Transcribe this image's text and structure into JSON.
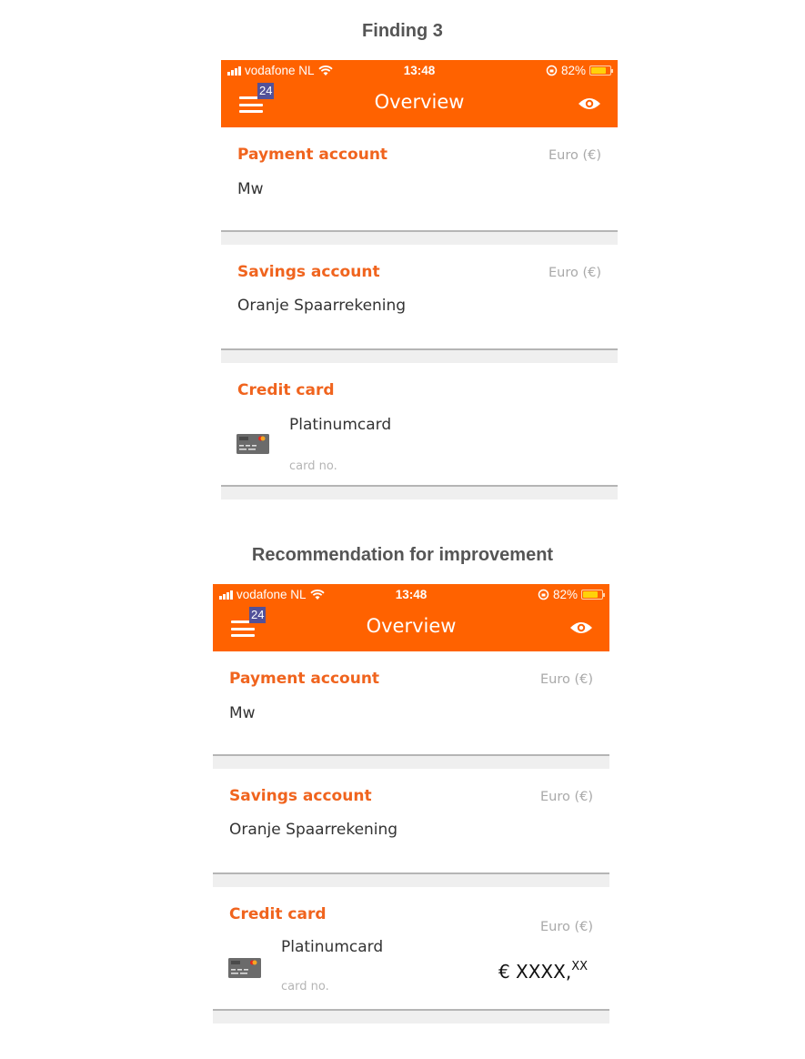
{
  "captions": {
    "finding": "Finding 3",
    "recommendation": "Recommendation for improvement"
  },
  "status_bar": {
    "carrier": "vodafone NL",
    "time": "13:48",
    "battery_text": "82%",
    "battery_level": 0.82
  },
  "header": {
    "title": "Overview",
    "badge_count": "24",
    "menu_icon": "hamburger-icon",
    "right_icon": "eye-icon"
  },
  "colors": {
    "brand_orange": "#ff6200",
    "section_title": "#f0641e",
    "badge_bg": "#525199"
  },
  "phones": [
    {
      "id": "finding",
      "sections": {
        "payment": {
          "title": "Payment account",
          "currency": "Euro (€)",
          "name": "Mw"
        },
        "savings": {
          "title": "Savings account",
          "currency": "Euro (€)",
          "name": "Oranje Spaarrekening"
        },
        "credit": {
          "title": "Credit card",
          "card_name": "Platinumcard",
          "card_no_label": "card no."
        }
      }
    },
    {
      "id": "recommendation",
      "sections": {
        "payment": {
          "title": "Payment account",
          "currency": "Euro (€)",
          "name": "Mw"
        },
        "savings": {
          "title": "Savings account",
          "currency": "Euro (€)",
          "name": "Oranje Spaarrekening"
        },
        "credit": {
          "title": "Credit card",
          "currency": "Euro (€)",
          "card_name": "Platinumcard",
          "card_no_label": "card no.",
          "amount_main": "€ XXXX,",
          "amount_cents": "XX"
        }
      }
    }
  ]
}
